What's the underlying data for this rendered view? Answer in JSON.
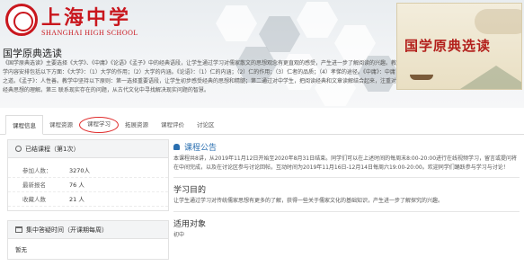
{
  "header": {
    "school_cn": "上海中学",
    "school_en": "SHANGHAI HIGH SCHOOL",
    "cover_title": "国学原典选读"
  },
  "course": {
    "title": "国学原典选读",
    "description": "《国学原典选读》主要选择《大学》、《中庸》《论语》《孟子》中的经典语段，让学生通过学习对儒家散文的思想观念有更直观的感受，产生进一步了解阅读的兴趣。教学内容安排包括以下方面：《大学》：（1）大学的作用；（2）大学的内涵。《论语》：（1）仁的内涵；（2）仁的作用；（3）仁者的品质；（4）孝悌的途径。《中庸》：中庸之道。《孟子》：人性善。教学中坚持以下原则：第一选择重要语段，让学生初步感受经典的思想和精髓；第二通过对中学生，把阅读经典和文章读解结合起来，注重对经典思想的理解。第三 联系现实存在的问题，从古代文化中寻找解决现实问题的智慧。"
  },
  "tabs": [
    {
      "label": "课程信息",
      "active": true
    },
    {
      "label": "课程资源"
    },
    {
      "label": "课程学习",
      "circled": true
    },
    {
      "label": "拓展资源"
    },
    {
      "label": "课程评价"
    },
    {
      "label": "讨论区"
    }
  ],
  "status_panel": {
    "header": "已结课程（第1次）",
    "rows": [
      {
        "key": "参加人数：",
        "value": "3270人"
      },
      {
        "key": "最新报名",
        "value": "76 人"
      },
      {
        "key": "收藏人数",
        "value": "21 人"
      }
    ]
  },
  "qa_panel": {
    "header": "集中答疑时间（开课期每周）",
    "value": "暂无"
  },
  "notice": {
    "title": "课程公告",
    "text": "本课程共8讲，从2019年11月12日开始至2020年8月31日结束。同学们可以在上述时间的每周末8:00-20:00进行在线视频学习，留言或提问将在中间完成，以及在讨论区参与讨论回帖，互动时间为2019年11月16日-12月14日每周六19:00-20:00。欢迎同学们踊跃参与学习与讨论！"
  },
  "objective": {
    "title": "学习目的",
    "text": "让学生通过学习对传统儒家思想有更多的了解，获得一些关于儒家文化的基础知识，产生进一步了解探究的兴趣。"
  },
  "audience": {
    "title": "适用对象",
    "text": "初中"
  },
  "colors": {
    "brand_red": "#c9171e",
    "notice_blue": "#2a6fb0",
    "circle_red": "#e02b2b"
  }
}
